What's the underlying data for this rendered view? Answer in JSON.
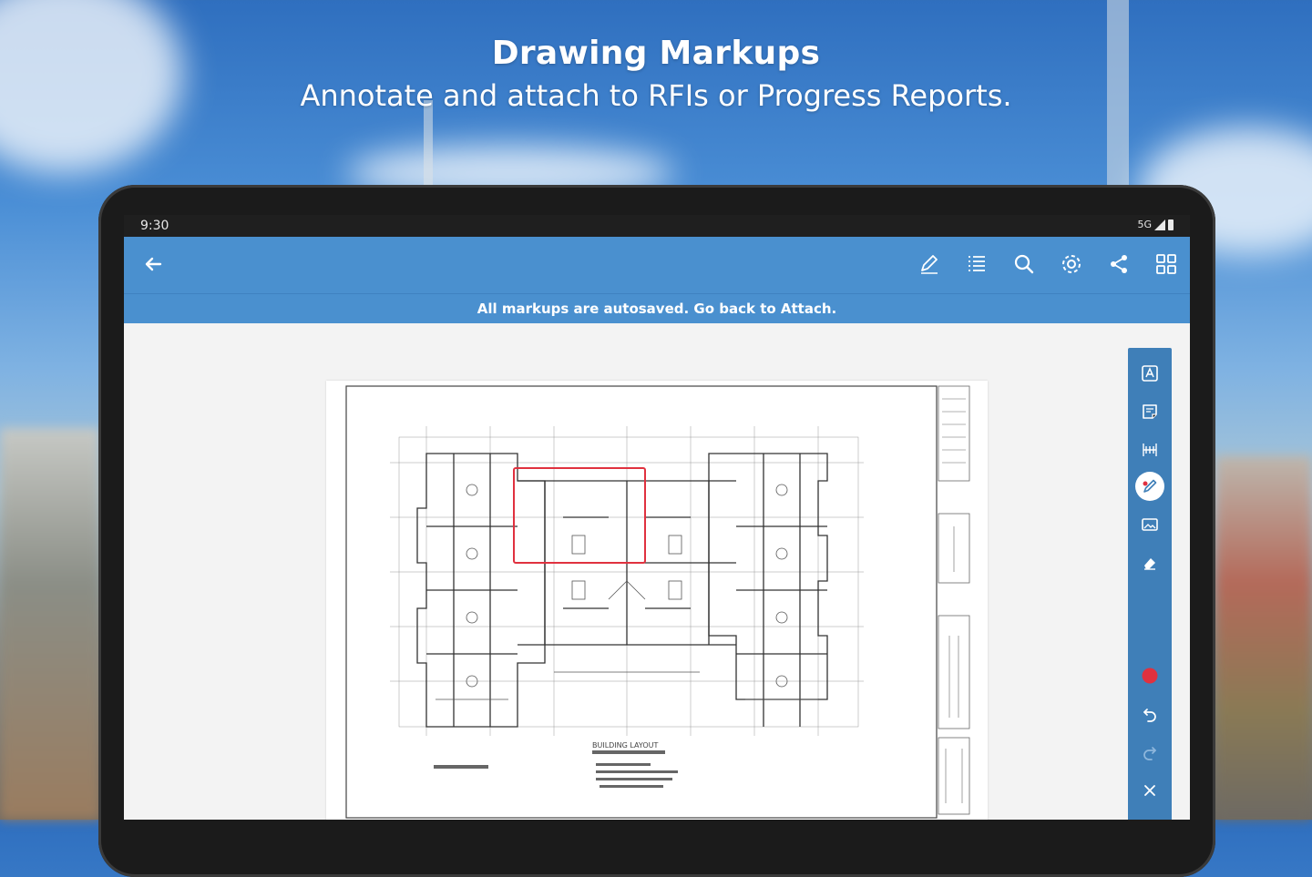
{
  "hero": {
    "title": "Drawing Markups",
    "subtitle": "Annotate and attach to RFIs or Progress Reports."
  },
  "statusbar": {
    "time": "9:30",
    "network": "5G"
  },
  "appbar": {
    "back_icon": "back-arrow-icon",
    "actions": [
      "pencil-icon",
      "list-icon",
      "search-icon",
      "gear-icon",
      "share-icon",
      "grid-icon"
    ]
  },
  "banner": {
    "text": "All markups are autosaved. Go back to Attach."
  },
  "drawing": {
    "title": "BUILDING LAYOUT",
    "markup_color": "#e0313f"
  },
  "toolbar": {
    "tools": [
      "text-icon",
      "note-icon",
      "measure-icon",
      "pen-icon",
      "image-icon",
      "eraser-icon"
    ],
    "active_tool": "pen-icon",
    "color_swatch": "#e0313f",
    "controls": [
      "undo-icon",
      "redo-icon",
      "close-icon"
    ]
  },
  "colors": {
    "appbar": "#4a90cf",
    "toolbar": "#3f7fb8"
  }
}
